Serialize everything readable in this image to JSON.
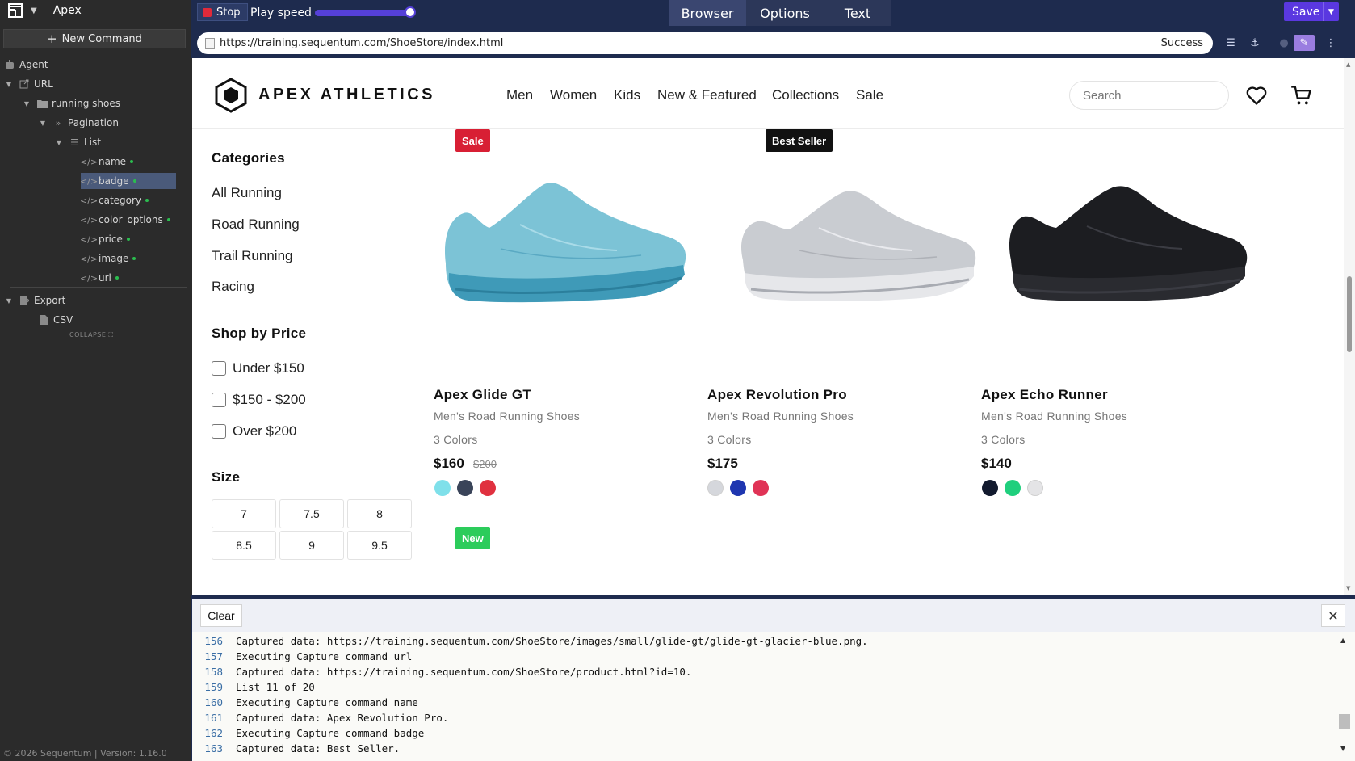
{
  "app": {
    "title": "Apex",
    "new_command_label": "New Command",
    "collapse_label": "COLLAPSE",
    "footer": "© 2026 Sequentum | Version: 1.16.0"
  },
  "tree": {
    "agent": "Agent",
    "url": "URL",
    "running_shoes": "running shoes",
    "pagination": "Pagination",
    "list": "List",
    "fields": [
      "name",
      "badge",
      "category",
      "color_options",
      "price",
      "image",
      "url"
    ],
    "selected_field": "badge",
    "export": "Export",
    "csv": "CSV"
  },
  "toolbar": {
    "stop_label": "Stop",
    "play_speed_label": "Play speed",
    "play_speed_level": 0.95,
    "tabs": [
      "Browser",
      "Options",
      "Text"
    ],
    "active_tab": "Browser",
    "save_label": "Save"
  },
  "address": {
    "url": "https://training.sequentum.com/ShoeStore/index.html",
    "status": "Success"
  },
  "site": {
    "brand": "APEX ATHLETICS",
    "nav": [
      "Men",
      "Women",
      "Kids",
      "New & Featured",
      "Collections",
      "Sale"
    ],
    "search_placeholder": "Search",
    "categories_title": "Categories",
    "categories": [
      "All Running",
      "Road Running",
      "Trail Running",
      "Racing"
    ],
    "price_title": "Shop by Price",
    "price_options": [
      "Under $150",
      "$150 - $200",
      "Over $200"
    ],
    "size_title": "Size",
    "sizes": [
      "7",
      "7.5",
      "8",
      "8.5",
      "9",
      "9.5"
    ],
    "products": [
      {
        "badge": "Sale",
        "badge_color": "#d81f34",
        "name": "Apex Glide GT",
        "category": "Men's Road Running Shoes",
        "colors_text": "3 Colors",
        "price": "$160",
        "old_price": "$200",
        "swatches": [
          "#7fe0ea",
          "#3a4459",
          "#e0313f"
        ]
      },
      {
        "badge": "Best Seller",
        "badge_color": "#111111",
        "name": "Apex Revolution Pro",
        "category": "Men's Road Running Shoes",
        "colors_text": "3 Colors",
        "price": "$175",
        "old_price": "",
        "swatches": [
          "#d5d7dc",
          "#1f36b0",
          "#e03356"
        ]
      },
      {
        "badge": "",
        "badge_color": "",
        "name": "Apex Echo Runner",
        "category": "Men's Road Running Shoes",
        "colors_text": "3 Colors",
        "price": "$140",
        "old_price": "",
        "swatches": [
          "#121a2e",
          "#1fcf7d",
          "#e4e4e6"
        ]
      }
    ],
    "next_badge": "New",
    "next_badge_color": "#2ccc5b"
  },
  "log": {
    "clear_label": "Clear",
    "lines": [
      {
        "n": "156",
        "text": "Captured data: https://training.sequentum.com/ShoeStore/images/small/glide-gt/glide-gt-glacier-blue.png."
      },
      {
        "n": "157",
        "text": "Executing Capture command url"
      },
      {
        "n": "158",
        "text": "Captured data: https://training.sequentum.com/ShoeStore/product.html?id=10."
      },
      {
        "n": "159",
        "text": "List 11 of 20"
      },
      {
        "n": "160",
        "text": "Executing Capture command name"
      },
      {
        "n": "161",
        "text": "Captured data: Apex Revolution Pro."
      },
      {
        "n": "162",
        "text": "Executing Capture command badge"
      },
      {
        "n": "163",
        "text": "Captured data: Best Seller."
      }
    ]
  }
}
